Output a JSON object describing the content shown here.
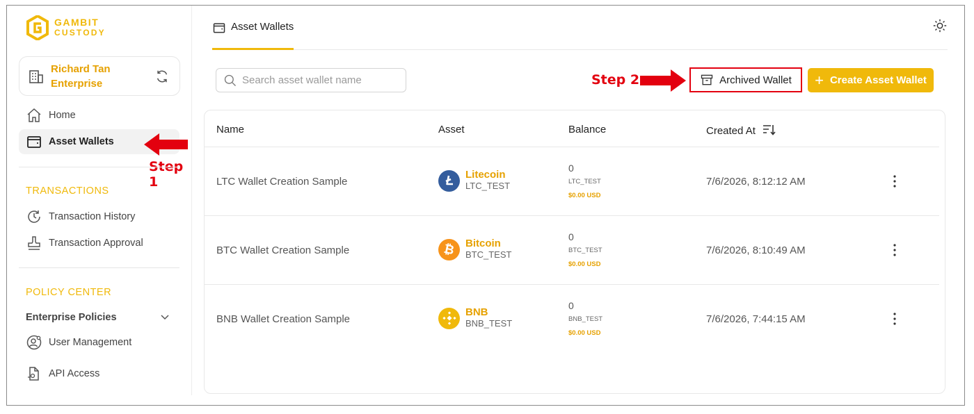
{
  "brand": {
    "line1": "GAMBIT",
    "line2": "CUSTODY"
  },
  "org": {
    "name_line1": "Richard Tan",
    "name_line2": "Enterprise"
  },
  "nav": {
    "home": "Home",
    "asset_wallets": "Asset Wallets",
    "transactions_title": "TRANSACTIONS",
    "transaction_history": "Transaction History",
    "transaction_approval": "Transaction Approval",
    "policy_center_title": "POLICY CENTER",
    "enterprise_policies": "Enterprise Policies",
    "user_management": "User Management",
    "api_access": "API Access"
  },
  "header": {
    "tab_label": "Asset Wallets"
  },
  "toolbar": {
    "search_placeholder": "Search asset wallet name",
    "archived_label": "Archived Wallet",
    "create_label": "Create Asset Wallet"
  },
  "annotations": {
    "step1": "Step 1",
    "step2": "Step 2",
    "color": "#e3000f"
  },
  "accent_color": "#f0b90b",
  "table": {
    "columns": [
      "Name",
      "Asset",
      "Balance",
      "Created At"
    ],
    "rows": [
      {
        "name": "LTC Wallet Creation Sample",
        "asset_name": "Litecoin",
        "asset_code": "LTC_TEST",
        "icon": "litecoin-icon",
        "coin_color": "#345d9d",
        "balance": "0",
        "balance_code": "LTC_TEST",
        "balance_usd": "$0.00 USD",
        "created_at": "7/6/2026, 8:12:12 AM"
      },
      {
        "name": "BTC Wallet Creation Sample",
        "asset_name": "Bitcoin",
        "asset_code": "BTC_TEST",
        "icon": "bitcoin-icon",
        "coin_color": "#f7931a",
        "balance": "0",
        "balance_code": "BTC_TEST",
        "balance_usd": "$0.00 USD",
        "created_at": "7/6/2026, 8:10:49 AM"
      },
      {
        "name": "BNB Wallet Creation Sample",
        "asset_name": "BNB",
        "asset_code": "BNB_TEST",
        "icon": "bnb-icon",
        "coin_color": "#f0b90b",
        "balance": "0",
        "balance_code": "BNB_TEST",
        "balance_usd": "$0.00 USD",
        "created_at": "7/6/2026, 7:44:15 AM"
      }
    ]
  }
}
